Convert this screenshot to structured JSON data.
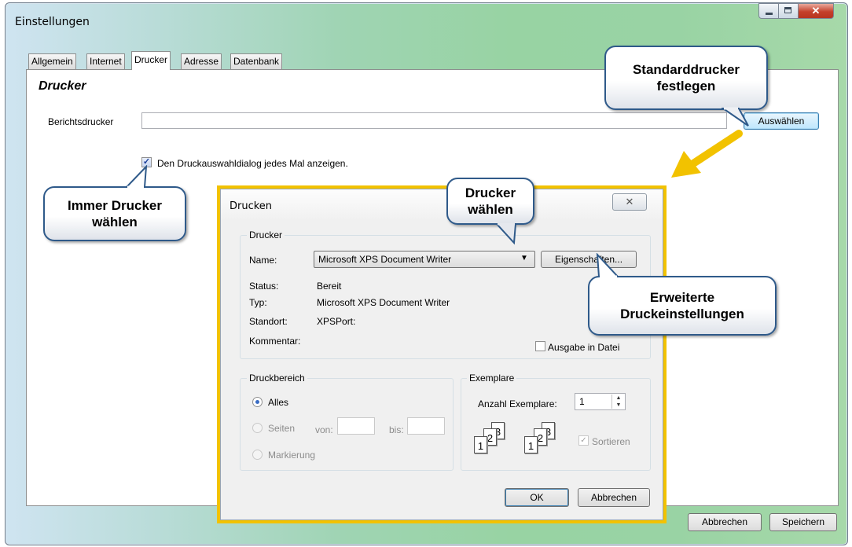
{
  "window": {
    "title": "Einstellungen",
    "close_glyph": "✕"
  },
  "tabs": [
    {
      "label": "Allgemein"
    },
    {
      "label": "Internet"
    },
    {
      "label": "Drucker",
      "active": true
    },
    {
      "label": "Adresse"
    },
    {
      "label": "Datenbank"
    }
  ],
  "drucker_tab": {
    "section_title": "Drucker",
    "report_printer_label": "Berichtsdrucker",
    "report_printer_value": "",
    "select_button": "Auswählen",
    "show_dialog_label": "Den Druckauswahldialog jedes Mal anzeigen.",
    "show_dialog_checked": true
  },
  "footer": {
    "cancel": "Abbrechen",
    "save": "Speichern"
  },
  "callouts": {
    "default_printer": "Standarddrucker\nfestlegen",
    "always_choose": "Immer Drucker\nwählen",
    "choose_printer": "Drucker\nwählen",
    "advanced": "Erweiterte\nDruckeinstellungen"
  },
  "dialog": {
    "title": "Drucken",
    "close_glyph": "✕",
    "printer_group": "Drucker",
    "name_label": "Name:",
    "printer_name": "Microsoft XPS Document Writer",
    "properties_button": "Eigenschaften...",
    "status_label": "Status:",
    "status_value": "Bereit",
    "type_label": "Typ:",
    "type_value": "Microsoft XPS Document Writer",
    "location_label": "Standort:",
    "location_value": "XPSPort:",
    "comment_label": "Kommentar:",
    "print_to_file": "Ausgabe in Datei",
    "range_group": "Druckbereich",
    "range_all": "Alles",
    "range_pages": "Seiten",
    "from_label": "von:",
    "to_label": "bis:",
    "range_selection": "Markierung",
    "copies_group": "Exemplare",
    "copies_label": "Anzahl Exemplare:",
    "copies_value": "1",
    "collate_label": "Sortieren",
    "ok": "OK",
    "cancel": "Abbrechen"
  },
  "colors": {
    "highlight_frame": "#f2c200",
    "arrow": "#f2c200",
    "callout_border": "#2f5a8a"
  },
  "icons": [
    "minimize-icon",
    "maximize-icon",
    "close-icon",
    "checkbox-checked-icon",
    "dropdown-arrow-icon",
    "spinner-icon",
    "collate-pages-icon",
    "arrow-icon"
  ]
}
